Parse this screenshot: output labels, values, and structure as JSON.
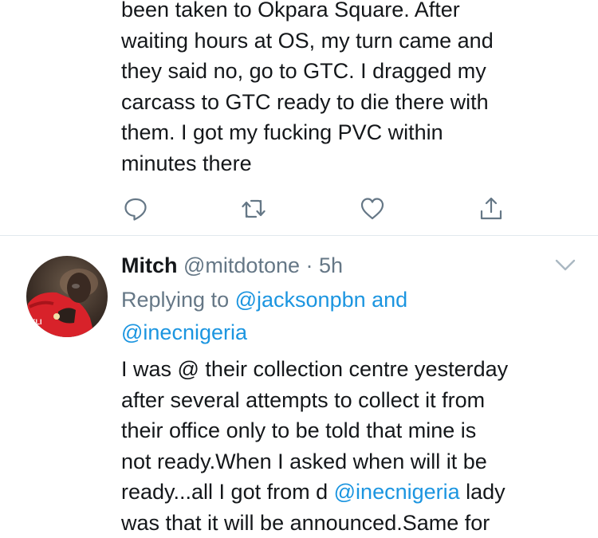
{
  "prev_tweet": {
    "lines": [
      "been taken to Okpara Square. After",
      "waiting hours at OS, my turn came and",
      "they said no, go to GTC. I dragged my",
      "carcass to GTC ready to die there with",
      "them. I got my fucking PVC within",
      "minutes there"
    ]
  },
  "actions": {
    "reply_icon": "reply-icon",
    "retweet_icon": "retweet-icon",
    "like_icon": "heart-icon",
    "share_icon": "share-icon"
  },
  "tweet": {
    "name": "Mitch",
    "handle": "@mitdotone",
    "separator": "·",
    "time": "5h",
    "replying_prefix": "Replying to",
    "reply_handle_1": "@jacksonpbn",
    "reply_and": "and",
    "reply_handle_2": "@inecnigeria",
    "lines": [
      "I was @ their collection centre yesterday",
      "after several attempts to collect it from",
      "their office only to be told that mine is",
      "not ready.When I asked when will it be"
    ],
    "line5_before": "ready...all I got from d",
    "line5_mention": "@inecnigeria",
    "line5_after": "lady",
    "line6": "was that it will be announced.Same for"
  },
  "colors": {
    "text": "#14171a",
    "secondary": "#657786",
    "link": "#1b95e0",
    "divider": "#e1e8ed"
  }
}
